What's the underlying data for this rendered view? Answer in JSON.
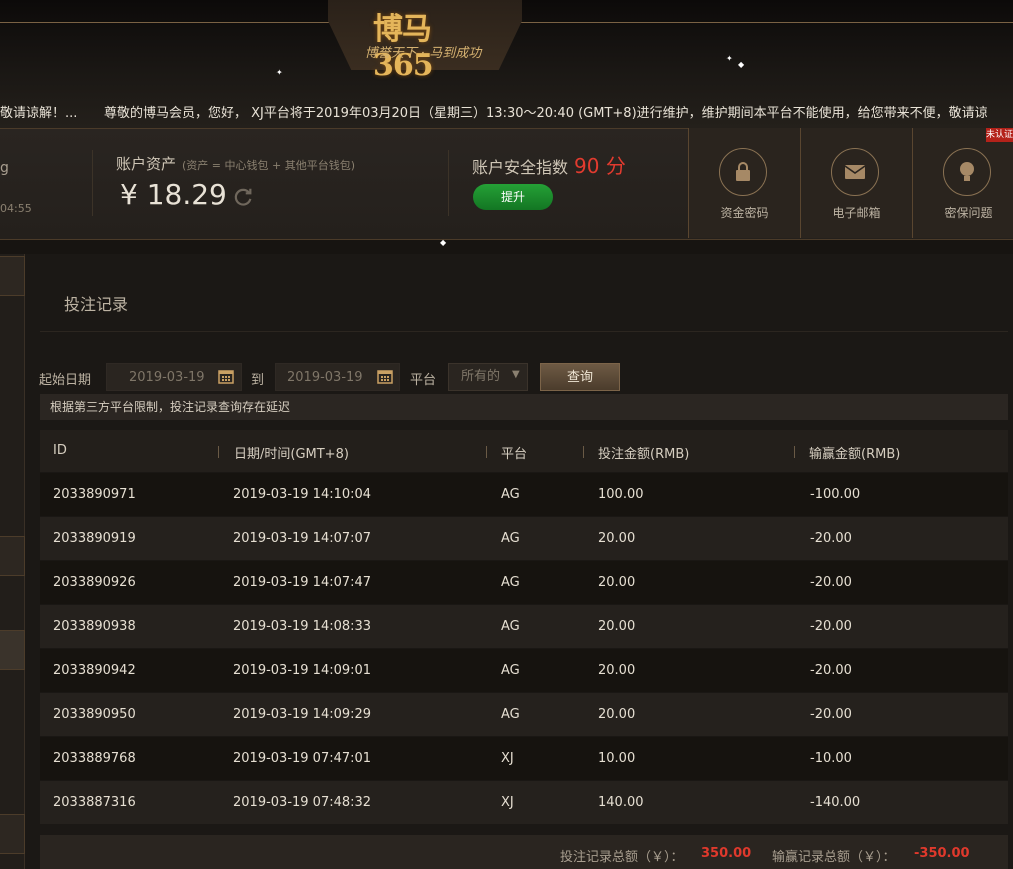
{
  "header": {
    "logo_text": "博马365",
    "slogan": "博誉天下 · 马到成功",
    "marquee_lead": "敬请谅解！...",
    "marquee_text": "尊敬的博马会员，您好， XJ平台将于2019年03月20日（星期三）13:30～20:40 (GMT+8)进行维护，维护期间本平台不能使用，给您带来不便，敬请谅"
  },
  "account": {
    "left_partial": "g",
    "left_time": "04:55",
    "assets_label": "账户资产",
    "assets_note": "(资产 = 中心钱包 + 其他平台钱包)",
    "assets_value": "¥ 18.29",
    "security_label": "账户安全指数",
    "security_score": "90 分",
    "upgrade_label": "提升",
    "shortcuts": [
      {
        "label": "资金密码",
        "icon": "lock-icon"
      },
      {
        "label": "电子邮箱",
        "icon": "mail-icon"
      },
      {
        "label": "密保问题",
        "icon": "lightbulb-icon"
      }
    ],
    "unverified_tag": "未认证"
  },
  "page": {
    "title": "投注记录",
    "filter": {
      "start_label": "起始日期",
      "start_date": "2019-03-19",
      "to_label": "到",
      "end_date": "2019-03-19",
      "platform_label": "平台",
      "platform_value": "所有的",
      "query_label": "查询"
    },
    "notice": "根据第三方平台限制，投注记录查询存在延迟"
  },
  "table": {
    "headers": [
      "ID",
      "日期/时间(GMT+8)",
      "平台",
      "投注金额(RMB)",
      "输赢金额(RMB)"
    ],
    "rows": [
      [
        "2033890971",
        "2019-03-19 14:10:04",
        "AG",
        "100.00",
        "-100.00"
      ],
      [
        "2033890919",
        "2019-03-19 14:07:07",
        "AG",
        "20.00",
        "-20.00"
      ],
      [
        "2033890926",
        "2019-03-19 14:07:47",
        "AG",
        "20.00",
        "-20.00"
      ],
      [
        "2033890938",
        "2019-03-19 14:08:33",
        "AG",
        "20.00",
        "-20.00"
      ],
      [
        "2033890942",
        "2019-03-19 14:09:01",
        "AG",
        "20.00",
        "-20.00"
      ],
      [
        "2033890950",
        "2019-03-19 14:09:29",
        "AG",
        "20.00",
        "-20.00"
      ],
      [
        "2033889768",
        "2019-03-19 07:47:01",
        "XJ",
        "10.00",
        "-10.00"
      ],
      [
        "2033887316",
        "2019-03-19 07:48:32",
        "XJ",
        "140.00",
        "-140.00"
      ]
    ]
  },
  "summary": {
    "bet_total_label": "投注记录总额（￥）：",
    "bet_total_value": "350.00",
    "win_total_label": "输赢记录总额（￥）：",
    "win_total_value": "-350.00"
  },
  "colors": {
    "accent_gold": "#c9a063",
    "score_red": "#e23b2f",
    "upgrade_green": "#1f8f30"
  }
}
